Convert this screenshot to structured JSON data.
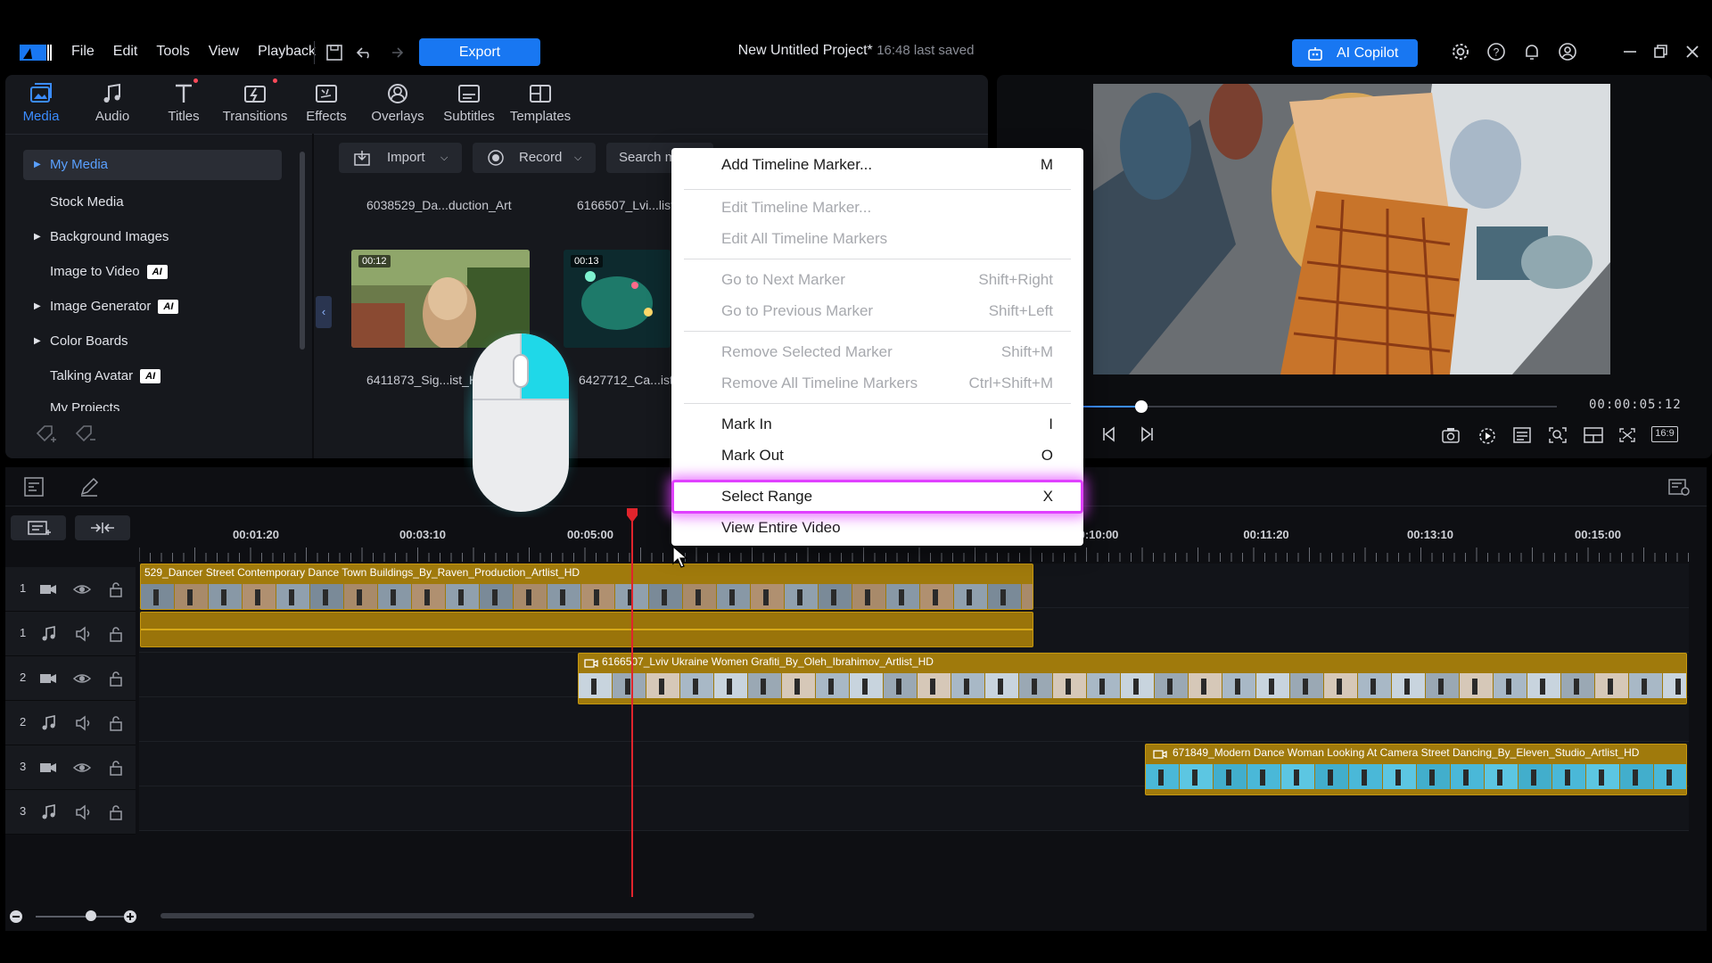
{
  "menu": [
    "File",
    "Edit",
    "Tools",
    "View",
    "Playback"
  ],
  "export_label": "Export",
  "project": {
    "title": "New Untitled Project*",
    "saved": "16:48 last saved"
  },
  "copilot_label": "AI Copilot",
  "tabs": [
    {
      "label": "Media",
      "active": true,
      "dot": false
    },
    {
      "label": "Audio",
      "active": false,
      "dot": false
    },
    {
      "label": "Titles",
      "active": false,
      "dot": true
    },
    {
      "label": "Transitions",
      "active": false,
      "dot": true
    },
    {
      "label": "Effects",
      "active": false,
      "dot": false
    },
    {
      "label": "Overlays",
      "active": false,
      "dot": false
    },
    {
      "label": "Subtitles",
      "active": false,
      "dot": false
    },
    {
      "label": "Templates",
      "active": false,
      "dot": false
    }
  ],
  "tree": [
    {
      "label": "My Media",
      "arrow": true,
      "ai": false,
      "selected": true
    },
    {
      "label": "Stock Media",
      "arrow": false,
      "ai": false,
      "selected": false
    },
    {
      "label": "Background Images",
      "arrow": true,
      "ai": false,
      "selected": false
    },
    {
      "label": "Image to Video",
      "arrow": false,
      "ai": true,
      "selected": false
    },
    {
      "label": "Image Generator",
      "arrow": true,
      "ai": true,
      "selected": false
    },
    {
      "label": "Color Boards",
      "arrow": true,
      "ai": false,
      "selected": false
    },
    {
      "label": "Talking Avatar",
      "arrow": false,
      "ai": true,
      "selected": false
    },
    {
      "label": "My Projects",
      "arrow": false,
      "ai": false,
      "selected": false
    }
  ],
  "ai_badge": "AI",
  "media_toolbar": {
    "import": "Import",
    "record": "Record",
    "search": "Search m"
  },
  "media": [
    {
      "name": "6038529_Da...duction_Art"
    },
    {
      "name": "6166507_Lvi...list"
    },
    {
      "name": "6411873_Sig...ist_H",
      "duration": "00:12"
    },
    {
      "name": "6427712_Ca...ist",
      "duration": "00:13"
    }
  ],
  "preview": {
    "timecode": "00:00:05:12",
    "progress": 0.12,
    "aspect": "16:9"
  },
  "ruler": [
    "00:01:20",
    "00:03:10",
    "00:05:00",
    "0:10:00",
    "00:11:20",
    "00:13:10",
    "00:15:00"
  ],
  "tracks": [
    {
      "num": "1",
      "kind": "video"
    },
    {
      "num": "1",
      "kind": "audio"
    },
    {
      "num": "2",
      "kind": "video"
    },
    {
      "num": "2",
      "kind": "audio"
    },
    {
      "num": "3",
      "kind": "video"
    },
    {
      "num": "3",
      "kind": "audio"
    }
  ],
  "clips": [
    {
      "title": "529_Dancer Street Contemporary Dance Town Buildings_By_Raven_Production_Artlist_HD"
    },
    {
      "title": "6166507_Lviv Ukraine Women Grafiti_By_Oleh_Ibrahimov_Artlist_HD"
    },
    {
      "title": "671849_Modern Dance Woman Looking At Camera Street Dancing_By_Eleven_Studio_Artlist_HD"
    }
  ],
  "context_menu": [
    {
      "label": "Add Timeline Marker...",
      "shortcut": "M",
      "enabled": true
    },
    {
      "label": "Edit Timeline Marker...",
      "shortcut": "",
      "enabled": false
    },
    {
      "label": "Edit All Timeline Markers",
      "shortcut": "",
      "enabled": false
    },
    {
      "label": "Go to Next Marker",
      "shortcut": "Shift+Right",
      "enabled": false
    },
    {
      "label": "Go to Previous Marker",
      "shortcut": "Shift+Left",
      "enabled": false
    },
    {
      "label": "Remove Selected Marker",
      "shortcut": "Shift+M",
      "enabled": false
    },
    {
      "label": "Remove All Timeline Markers",
      "shortcut": "Ctrl+Shift+M",
      "enabled": false
    },
    {
      "label": "Mark In",
      "shortcut": "I",
      "enabled": true
    },
    {
      "label": "Mark Out",
      "shortcut": "O",
      "enabled": true
    },
    {
      "label": "Select Range",
      "shortcut": "X",
      "enabled": true,
      "highlighted": true
    },
    {
      "label": "View Entire Video",
      "shortcut": "",
      "enabled": true
    }
  ],
  "colors": {
    "accent": "#1877f2",
    "clip": "#a07a0c",
    "playhead": "#e0242c",
    "highlight": "#e040ff"
  }
}
